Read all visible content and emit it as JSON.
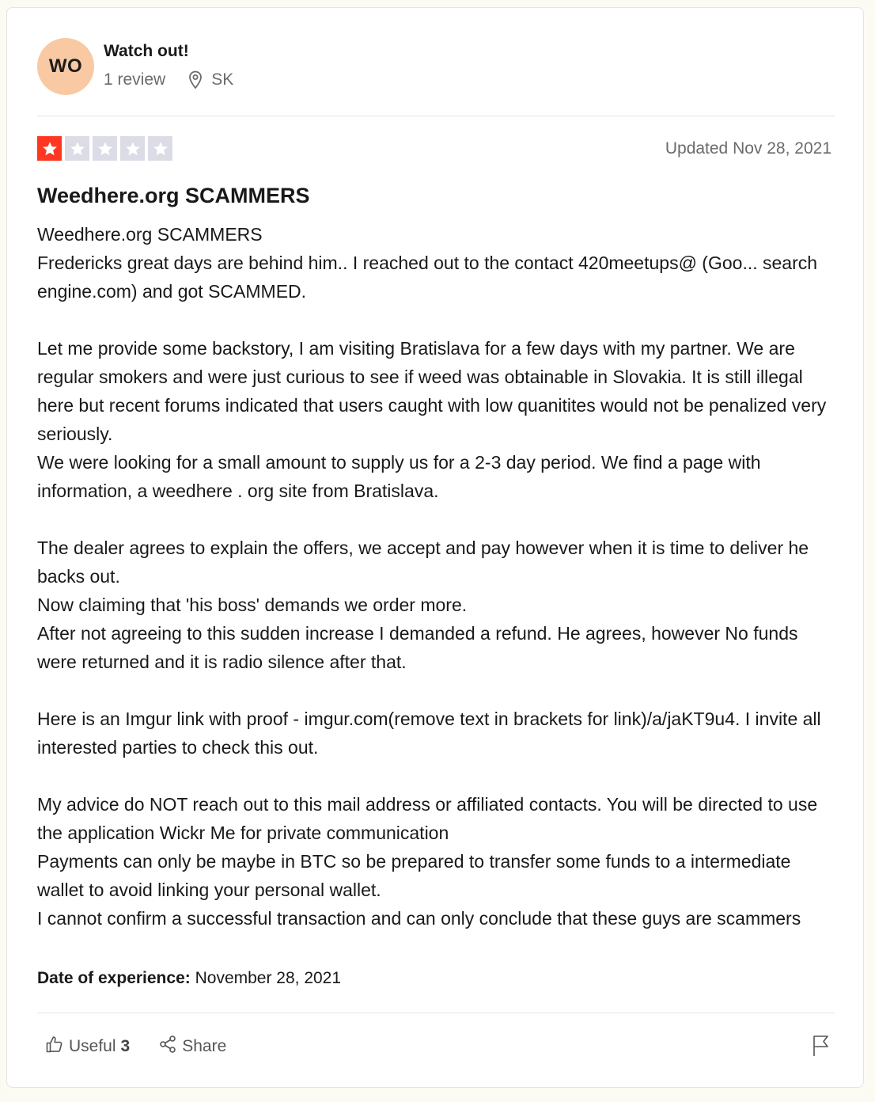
{
  "reviewer": {
    "initials": "WO",
    "name": "Watch out!",
    "review_count": "1 review",
    "country": "SK"
  },
  "review": {
    "rating": 1,
    "max_rating": 5,
    "updated": "Updated Nov 28, 2021",
    "title": "Weedhere.org SCAMMERS",
    "paragraphs": [
      [
        "Weedhere.org SCAMMERS",
        "Fredericks great days are behind him.. I reached out to the contact 420meetups@ (Goo... search engine.com) and got SCAMMED."
      ],
      [
        "Let me provide some backstory, I am visiting Bratislava for a few days with my partner. We are regular smokers and were just curious to see if weed was obtainable in Slovakia. It is still illegal here but recent forums indicated that users caught with low quanitites would not be penalized very seriously.",
        "We were looking for a small amount to supply us for a 2-3 day period. We find a page with information, a weedhere . org site from Bratislava."
      ],
      [
        "The dealer agrees to explain the offers, we accept and pay however when it is time to deliver he backs out.",
        "Now claiming that 'his boss' demands we order more.",
        "After not agreeing to this sudden increase I demanded a refund. He agrees, however No funds were returned and it is radio silence after that."
      ],
      [
        "Here is an Imgur link with proof - imgur.com(remove text in brackets for link)/a/jaKT9u4. I invite all interested parties to check this out."
      ],
      [
        "My advice do NOT reach out to this mail address or affiliated contacts. You will be directed to use the application Wickr Me for private communication",
        "Payments can only be maybe in BTC so be prepared to transfer some funds to a intermediate wallet to avoid linking your personal wallet.",
        "I cannot confirm a successful transaction and can only conclude that these guys are scammers"
      ]
    ],
    "date_label": "Date of experience:",
    "date_value": "November 28, 2021"
  },
  "actions": {
    "useful_label": "Useful",
    "useful_count": "3",
    "share_label": "Share"
  },
  "icons": {
    "location": "location-pin-icon",
    "star": "star-icon",
    "useful": "thumbs-up-icon",
    "share": "share-icon",
    "report": "flag-icon"
  },
  "colors": {
    "star_active": "#ff3722",
    "star_inactive": "#dcdce6",
    "avatar_bg": "#f8c9a2",
    "page_bg": "#fcfbf3"
  }
}
